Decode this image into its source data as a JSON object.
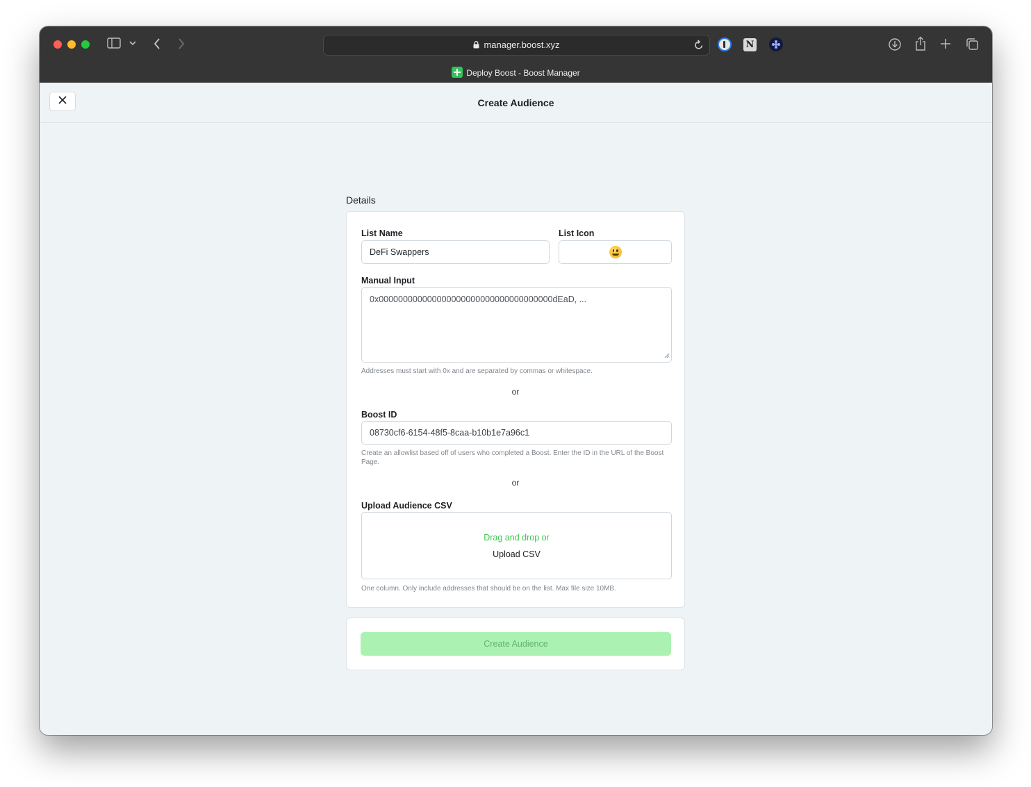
{
  "browser": {
    "url": "manager.boost.xyz",
    "tab_title": "Deploy Boost - Boost Manager"
  },
  "header": {
    "title": "Create Audience"
  },
  "form": {
    "section_label": "Details",
    "list_name": {
      "label": "List Name",
      "value": "DeFi Swappers"
    },
    "list_icon": {
      "label": "List Icon",
      "value": "grinning-face-emoji"
    },
    "manual_input": {
      "label": "Manual Input",
      "placeholder": "0x000000000000000000000000000000000000dEaD, ...",
      "helper": "Addresses must start with 0x and are separated by commas or whitespace."
    },
    "or_1": "or",
    "boost_id": {
      "label": "Boost ID",
      "value": "08730cf6-6154-48f5-8caa-b10b1e7a96c1",
      "helper": "Create an allowlist based off of users who completed a Boost. Enter the ID in the URL of the Boost Page."
    },
    "or_2": "or",
    "upload": {
      "label": "Upload Audience CSV",
      "drag_text": "Drag and drop or",
      "upload_text": "Upload CSV",
      "helper": "One column. Only include addresses that should be on the list. Max file size 10MB."
    },
    "submit_label": "Create Audience"
  },
  "colors": {
    "accent_green": "#39c84f",
    "submit_disabled_bg": "#abf2b2",
    "page_bg": "#eef3f6"
  }
}
